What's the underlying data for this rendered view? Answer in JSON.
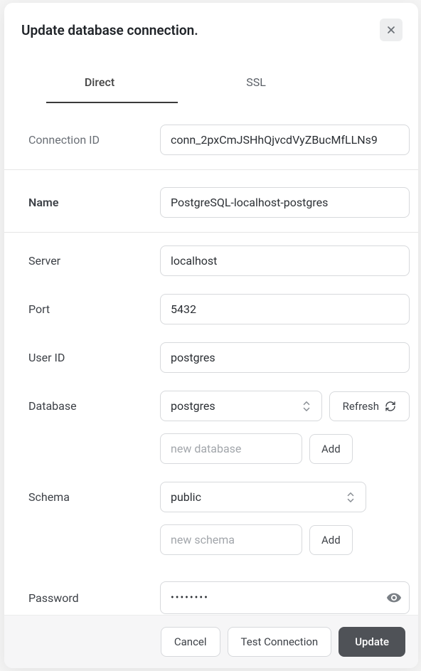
{
  "modal": {
    "title": "Update database connection."
  },
  "tabs": {
    "direct": "Direct",
    "ssl": "SSL"
  },
  "form": {
    "connectionId": {
      "label": "Connection ID",
      "value": "conn_2pxCmJSHhQjvcdVyZBucMfLLNs9"
    },
    "name": {
      "label": "Name",
      "value": "PostgreSQL-localhost-postgres"
    },
    "server": {
      "label": "Server",
      "value": "localhost"
    },
    "port": {
      "label": "Port",
      "value": "5432"
    },
    "userId": {
      "label": "User ID",
      "value": "postgres"
    },
    "database": {
      "label": "Database",
      "value": "postgres",
      "refresh": "Refresh",
      "newPlaceholder": "new database",
      "addLabel": "Add"
    },
    "schema": {
      "label": "Schema",
      "value": "public",
      "newPlaceholder": "new schema",
      "addLabel": "Add"
    },
    "password": {
      "label": "Password",
      "mask": "••••••••"
    }
  },
  "footer": {
    "cancel": "Cancel",
    "test": "Test Connection",
    "update": "Update"
  }
}
